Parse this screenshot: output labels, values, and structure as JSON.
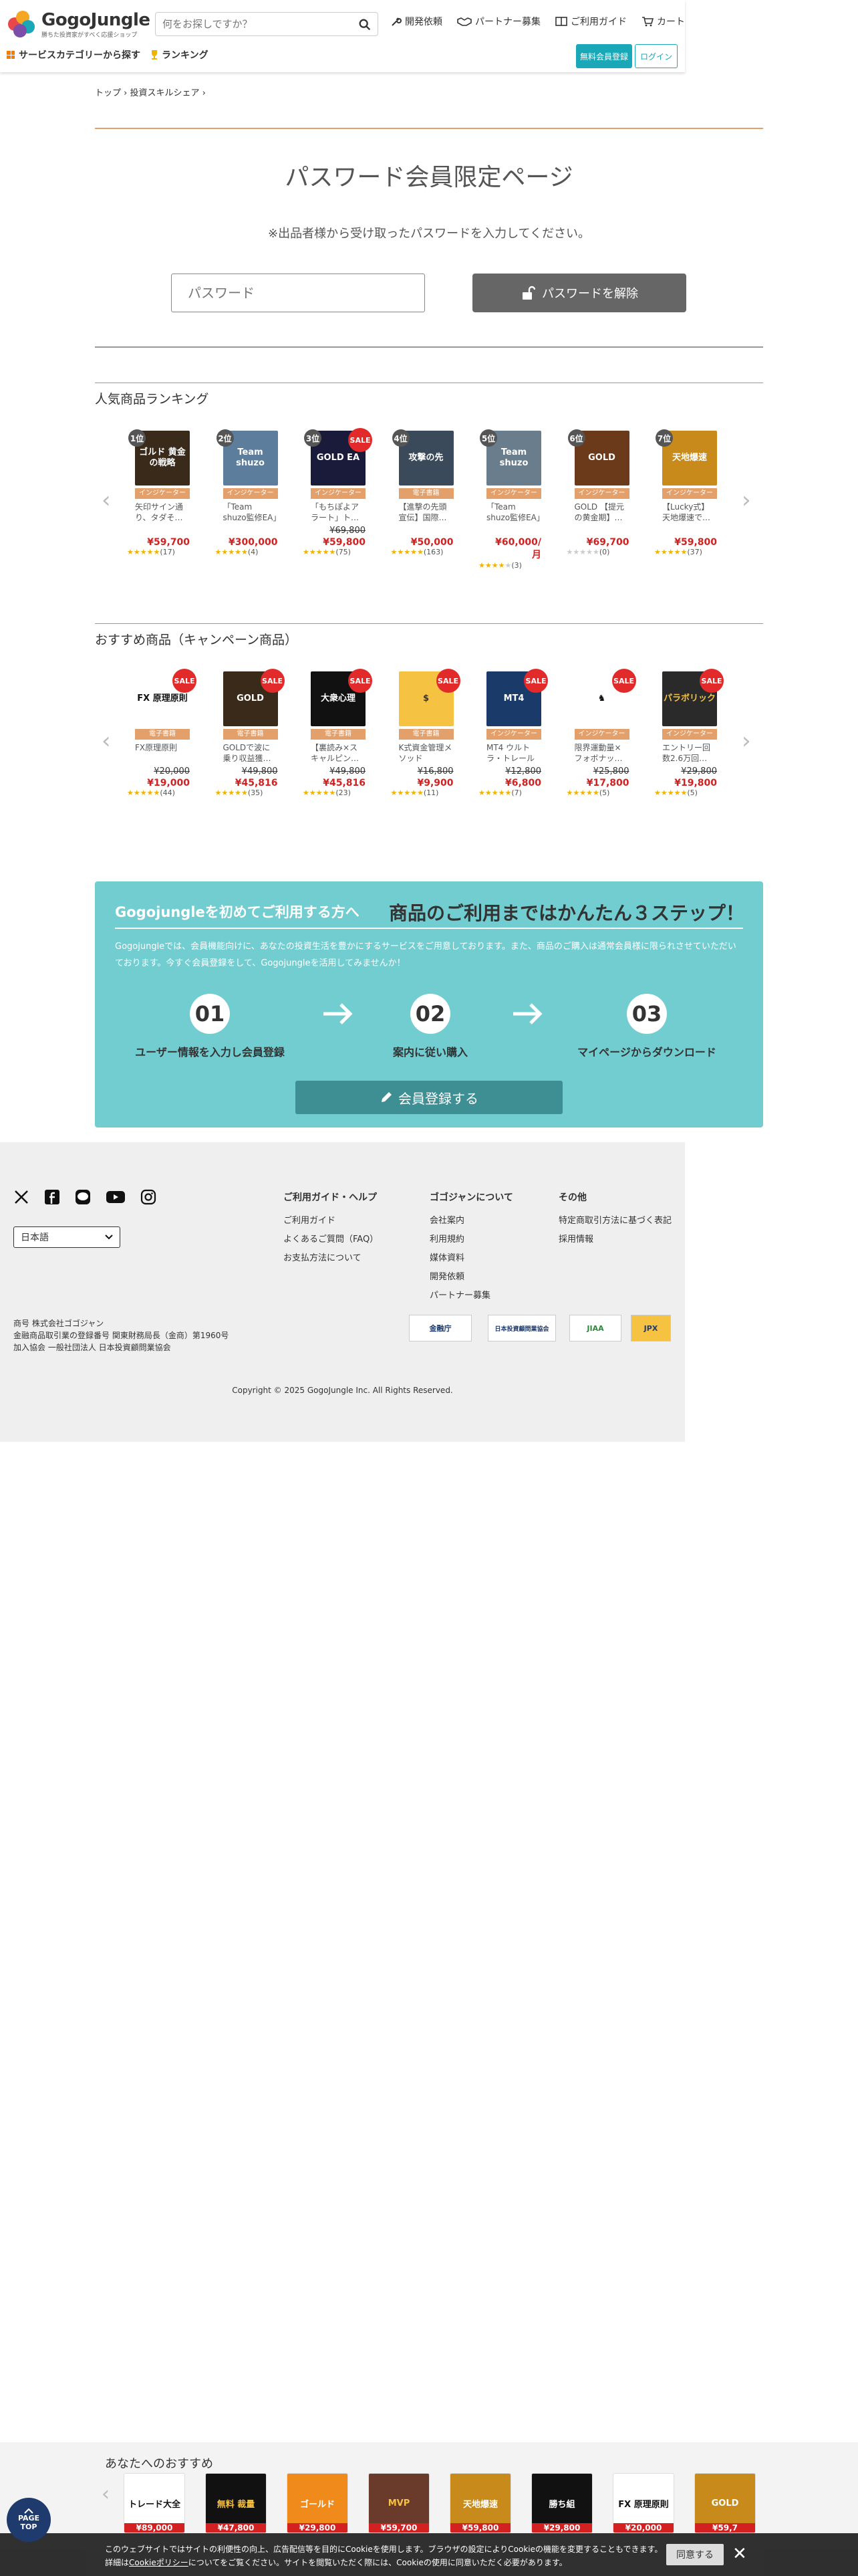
{
  "header": {
    "logo_name": "GogoJungle",
    "logo_tag": "勝ちた投資家がすべく応援ショップ",
    "search_placeholder": "何をお探しですか？",
    "nav": [
      "開発依頼",
      "パートナー募集",
      "ご利用ガイド",
      "カート"
    ],
    "subnav": [
      "サービスカテゴリーから探す",
      "ランキング"
    ],
    "register": "無料会員登録",
    "login": "ログイン"
  },
  "breadcrumb": "トップ › 投資スキルシェア ›",
  "password": {
    "title": "パスワード会員限定ページ",
    "subtitle": "※出品者様から受け取ったパスワードを入力してください。",
    "placeholder": "パスワード",
    "button": "パスワードを解除"
  },
  "ranking": {
    "title": "人気商品ランキング",
    "items": [
      {
        "rank": "1位",
        "img": "ゴルド 黄金の戦略",
        "bg": "#3a2a1a",
        "cat": "インジケーター",
        "name": "矢印サイン通り、タダそ…",
        "old": "",
        "price": "¥59,700",
        "rating": 5,
        "count": "(17)",
        "sale": false
      },
      {
        "rank": "2位",
        "img": "Team shuzo",
        "bg": "#5c7d9c",
        "cat": "インジケーター",
        "name": "「Team shuzo監修EA」",
        "old": "",
        "price": "¥300,000",
        "rating": 5,
        "count": "(4)",
        "sale": false
      },
      {
        "rank": "3位",
        "img": "GOLD EA",
        "bg": "#1a1a3a",
        "cat": "インジケーター",
        "name": "「もちぽよアラート」ト…",
        "old": "¥69,800",
        "price": "¥59,800",
        "rating": 5,
        "count": "(75)",
        "sale": true
      },
      {
        "rank": "4位",
        "img": "攻撃の先",
        "bg": "#3a4a5a",
        "cat": "電子書籍",
        "name": "【進撃の先頭宣伝】国際…",
        "old": "",
        "price": "¥50,000",
        "rating": 5,
        "count": "(163)",
        "sale": false
      },
      {
        "rank": "5位",
        "img": "Team shuzo",
        "bg": "#6a7d8c",
        "cat": "インジケーター",
        "name": "「Team shuzo監修EA」",
        "old": "",
        "price": "¥60,000/月",
        "rating": 4,
        "count": "(3)",
        "sale": false
      },
      {
        "rank": "6位",
        "img": "GOLD",
        "bg": "#6a3a1a",
        "cat": "インジケーター",
        "name": "GOLD 【提元の黄金期】…",
        "old": "",
        "price": "¥69,700",
        "rating": 0,
        "count": "(0)",
        "sale": false
      },
      {
        "rank": "7位",
        "img": "天地爆速",
        "bg": "#c88a1a",
        "cat": "インジケーター",
        "name": "【Lucky式】天地爆速で…",
        "old": "",
        "price": "¥59,800",
        "rating": 5,
        "count": "(37)",
        "sale": false
      }
    ]
  },
  "recommended": {
    "title": "おすすめ商品（キャンペーン商品）",
    "items": [
      {
        "img": "FX 原理原則",
        "bg": "#ffffff",
        "fg": "#111",
        "cat": "電子書籍",
        "name": "FX原理原則",
        "old": "¥20,000",
        "price": "¥19,000",
        "rating": 5,
        "count": "(44)",
        "sale": true
      },
      {
        "img": "GOLD",
        "bg": "#3a2a1a",
        "fg": "#fff",
        "cat": "電子書籍",
        "name": "GOLDで波に乗り収益獲…",
        "old": "¥49,800",
        "price": "¥45,816",
        "rating": 5,
        "count": "(35)",
        "sale": true
      },
      {
        "img": "大衆心理",
        "bg": "#111111",
        "fg": "#fff",
        "cat": "電子書籍",
        "name": "【裏読み×スキャルピン…",
        "old": "¥49,800",
        "price": "¥45,816",
        "rating": 5,
        "count": "(23)",
        "sale": true
      },
      {
        "img": "$",
        "bg": "#f5c242",
        "fg": "#333",
        "cat": "電子書籍",
        "name": "K式資金管理メソッド",
        "old": "¥16,800",
        "price": "¥9,900",
        "rating": 5,
        "count": "(11)",
        "sale": true
      },
      {
        "img": "MT4",
        "bg": "#1a3a6a",
        "fg": "#fff",
        "cat": "インジケーター",
        "name": "MT4 ウルトラ・トレール",
        "old": "¥12,800",
        "price": "¥6,800",
        "rating": 5,
        "count": "(7)",
        "sale": true
      },
      {
        "img": "♞",
        "bg": "#ffffff",
        "fg": "#111",
        "cat": "インジケーター",
        "name": "限界運動量×フォボナッ…",
        "old": "¥25,800",
        "price": "¥17,800",
        "rating": 5,
        "count": "(5)",
        "sale": true
      },
      {
        "img": "パラボリック",
        "bg": "#2a2a2a",
        "fg": "#f5c242",
        "cat": "インジケーター",
        "name": "エントリー回数2.6万回…",
        "old": "¥29,800",
        "price": "¥19,800",
        "rating": 5,
        "count": "(5)",
        "sale": true
      }
    ]
  },
  "banner": {
    "h1": "Gogojungleを初めてご利用する方へ",
    "h2": "商品のご利用まではかんたん３ステップ！",
    "desc": "Gogojungleでは、会員機能向けに、あなたの投資生活を豊かにするサービスをご用意しております。また、商品のご購入は通常会員様に限られさせていただいております。今すぐ会員登録をして、Gogojungleを活用してみませんか！",
    "steps": [
      {
        "num": "01",
        "label": "ユーザー情報を入力し会員登録"
      },
      {
        "num": "02",
        "label": "案内に従い購入"
      },
      {
        "num": "03",
        "label": "マイページからダウンロード"
      }
    ],
    "button": "会員登録する"
  },
  "footer": {
    "language": "日本語",
    "col1": {
      "title": "ご利用ガイド・ヘルプ",
      "links": [
        "ご利用ガイド",
        "よくあるご質問（FAQ）",
        "お支払方法について"
      ]
    },
    "col2": {
      "title": "ゴゴジャンについて",
      "links": [
        "会社案内",
        "利用規約",
        "媒体資料",
        "開発依頼",
        "パートナー募集"
      ]
    },
    "col3": {
      "title": "その他",
      "links": [
        "特定商取引方法に基づく表記",
        "採用情報"
      ]
    },
    "corp": [
      "商号 株式会社ゴゴジャン",
      "金融商品取引業の登録番号 関東財務局長（金商）第1960号",
      "加入協会 一般社団法人 日本投資顧問業協会"
    ],
    "badges": [
      "金融庁",
      "日本投資顧問業協会",
      "JIAA",
      "JPX"
    ],
    "copyright": "Copyright © 2025 GogoJungle Inc. All Rights Reserved."
  },
  "recbar": {
    "title": "あなたへのおすすめ",
    "items": [
      {
        "img": "トレード大全",
        "bg": "#ffffff",
        "fg": "#111",
        "price": "¥89,000"
      },
      {
        "img": "無料 裁量",
        "bg": "#111111",
        "fg": "#f5c242",
        "price": "¥47,800"
      },
      {
        "img": "ゴールド",
        "bg": "#f08a1a",
        "fg": "#fff",
        "price": "¥29,800"
      },
      {
        "img": "MVP",
        "bg": "#6a3a2a",
        "fg": "#f5c242",
        "price": "¥59,700"
      },
      {
        "img": "天地爆速",
        "bg": "#c88a1a",
        "fg": "#fff",
        "price": "¥59,800"
      },
      {
        "img": "勝ち組",
        "bg": "#111111",
        "fg": "#fff",
        "price": "¥29,800"
      },
      {
        "img": "FX 原理原則",
        "bg": "#ffffff",
        "fg": "#111",
        "price": "¥20,000"
      },
      {
        "img": "GOLD",
        "bg": "#c88a1a",
        "fg": "#fff",
        "price": "¥59,7"
      }
    ]
  },
  "pagetop": [
    "PAGE",
    "TOP"
  ],
  "cookie": {
    "line1": "このウェブサイトではサイトの利便性の向上、広告配信等を目的にCookieを使用します。ブラウザの設定によりCookieの機能を変更することもできます。",
    "line2a": "詳細は",
    "link": "Cookieポリシー",
    "line2b": "についてをご覧ください。サイトを閲覧いただく際には、Cookieの使用に同意いただく必要があります。",
    "button": "同意する"
  },
  "colors": {
    "accent": "#1aa8b8",
    "banner": "#72cdd1",
    "price": "#d32020",
    "category": "#e3a06b"
  }
}
